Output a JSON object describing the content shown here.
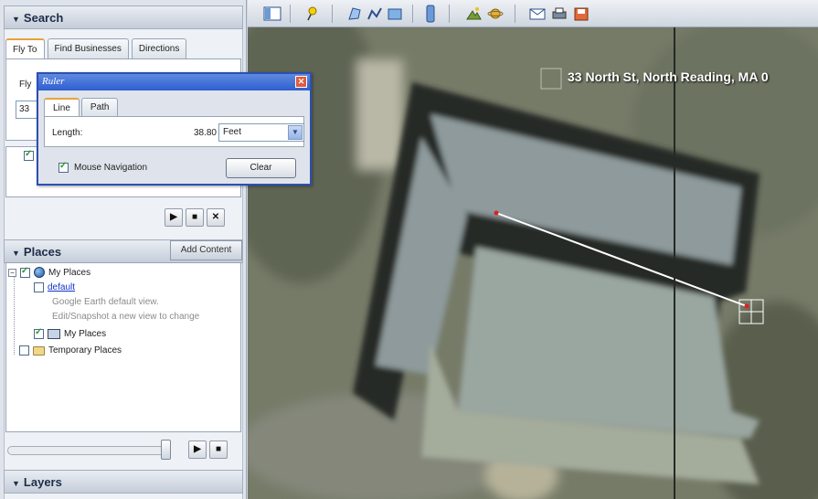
{
  "search": {
    "header": "Search",
    "tabs": [
      "Fly To",
      "Find Businesses",
      "Directions"
    ],
    "fly_partial": "Fly",
    "input_partial": "33"
  },
  "playback": {
    "play": "▶",
    "stop": "■",
    "close": "✕"
  },
  "places": {
    "header": "Places",
    "add_content": "Add Content",
    "items": {
      "my_places": "My Places",
      "default_link": "default",
      "default_desc1": "Google Earth default view.",
      "default_desc2": "Edit/Snapshot a new view to change",
      "my_places2": "My Places",
      "temporary": "Temporary Places"
    }
  },
  "tour": {
    "play": "▶",
    "stop": "■"
  },
  "layers": {
    "header": "Layers"
  },
  "ruler": {
    "title": "Ruler",
    "close": "✕",
    "tabs": [
      "Line",
      "Path"
    ],
    "length_label": "Length:",
    "length_value": "38.80",
    "unit": "Feet",
    "mouse_navigation": "Mouse Navigation",
    "clear": "Clear"
  },
  "map": {
    "address": "33 North St, North Reading, MA 0"
  },
  "colors": {
    "measure_line": "#ffffff",
    "endpoint": "#e02020",
    "title_bar": "#2f5ed0"
  }
}
